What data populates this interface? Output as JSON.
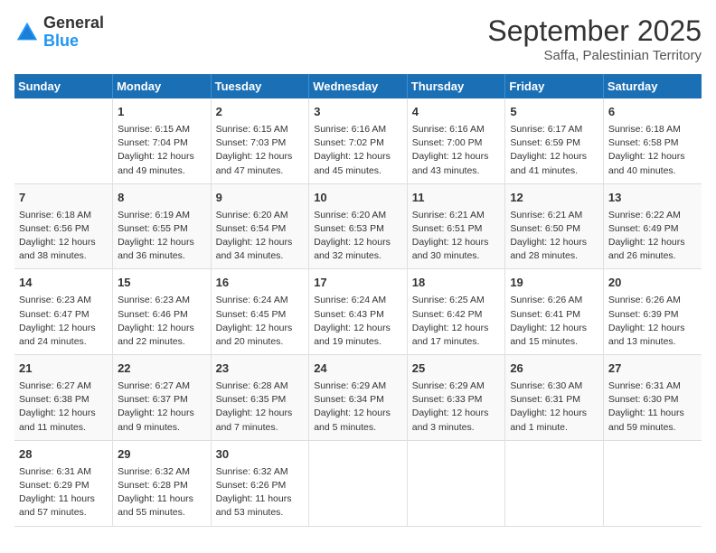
{
  "header": {
    "logo_general": "General",
    "logo_blue": "Blue",
    "month_title": "September 2025",
    "location": "Saffa, Palestinian Territory"
  },
  "days_of_week": [
    "Sunday",
    "Monday",
    "Tuesday",
    "Wednesday",
    "Thursday",
    "Friday",
    "Saturday"
  ],
  "weeks": [
    [
      {
        "day": "",
        "lines": []
      },
      {
        "day": "1",
        "lines": [
          "Sunrise: 6:15 AM",
          "Sunset: 7:04 PM",
          "Daylight: 12 hours",
          "and 49 minutes."
        ]
      },
      {
        "day": "2",
        "lines": [
          "Sunrise: 6:15 AM",
          "Sunset: 7:03 PM",
          "Daylight: 12 hours",
          "and 47 minutes."
        ]
      },
      {
        "day": "3",
        "lines": [
          "Sunrise: 6:16 AM",
          "Sunset: 7:02 PM",
          "Daylight: 12 hours",
          "and 45 minutes."
        ]
      },
      {
        "day": "4",
        "lines": [
          "Sunrise: 6:16 AM",
          "Sunset: 7:00 PM",
          "Daylight: 12 hours",
          "and 43 minutes."
        ]
      },
      {
        "day": "5",
        "lines": [
          "Sunrise: 6:17 AM",
          "Sunset: 6:59 PM",
          "Daylight: 12 hours",
          "and 41 minutes."
        ]
      },
      {
        "day": "6",
        "lines": [
          "Sunrise: 6:18 AM",
          "Sunset: 6:58 PM",
          "Daylight: 12 hours",
          "and 40 minutes."
        ]
      }
    ],
    [
      {
        "day": "7",
        "lines": [
          "Sunrise: 6:18 AM",
          "Sunset: 6:56 PM",
          "Daylight: 12 hours",
          "and 38 minutes."
        ]
      },
      {
        "day": "8",
        "lines": [
          "Sunrise: 6:19 AM",
          "Sunset: 6:55 PM",
          "Daylight: 12 hours",
          "and 36 minutes."
        ]
      },
      {
        "day": "9",
        "lines": [
          "Sunrise: 6:20 AM",
          "Sunset: 6:54 PM",
          "Daylight: 12 hours",
          "and 34 minutes."
        ]
      },
      {
        "day": "10",
        "lines": [
          "Sunrise: 6:20 AM",
          "Sunset: 6:53 PM",
          "Daylight: 12 hours",
          "and 32 minutes."
        ]
      },
      {
        "day": "11",
        "lines": [
          "Sunrise: 6:21 AM",
          "Sunset: 6:51 PM",
          "Daylight: 12 hours",
          "and 30 minutes."
        ]
      },
      {
        "day": "12",
        "lines": [
          "Sunrise: 6:21 AM",
          "Sunset: 6:50 PM",
          "Daylight: 12 hours",
          "and 28 minutes."
        ]
      },
      {
        "day": "13",
        "lines": [
          "Sunrise: 6:22 AM",
          "Sunset: 6:49 PM",
          "Daylight: 12 hours",
          "and 26 minutes."
        ]
      }
    ],
    [
      {
        "day": "14",
        "lines": [
          "Sunrise: 6:23 AM",
          "Sunset: 6:47 PM",
          "Daylight: 12 hours",
          "and 24 minutes."
        ]
      },
      {
        "day": "15",
        "lines": [
          "Sunrise: 6:23 AM",
          "Sunset: 6:46 PM",
          "Daylight: 12 hours",
          "and 22 minutes."
        ]
      },
      {
        "day": "16",
        "lines": [
          "Sunrise: 6:24 AM",
          "Sunset: 6:45 PM",
          "Daylight: 12 hours",
          "and 20 minutes."
        ]
      },
      {
        "day": "17",
        "lines": [
          "Sunrise: 6:24 AM",
          "Sunset: 6:43 PM",
          "Daylight: 12 hours",
          "and 19 minutes."
        ]
      },
      {
        "day": "18",
        "lines": [
          "Sunrise: 6:25 AM",
          "Sunset: 6:42 PM",
          "Daylight: 12 hours",
          "and 17 minutes."
        ]
      },
      {
        "day": "19",
        "lines": [
          "Sunrise: 6:26 AM",
          "Sunset: 6:41 PM",
          "Daylight: 12 hours",
          "and 15 minutes."
        ]
      },
      {
        "day": "20",
        "lines": [
          "Sunrise: 6:26 AM",
          "Sunset: 6:39 PM",
          "Daylight: 12 hours",
          "and 13 minutes."
        ]
      }
    ],
    [
      {
        "day": "21",
        "lines": [
          "Sunrise: 6:27 AM",
          "Sunset: 6:38 PM",
          "Daylight: 12 hours",
          "and 11 minutes."
        ]
      },
      {
        "day": "22",
        "lines": [
          "Sunrise: 6:27 AM",
          "Sunset: 6:37 PM",
          "Daylight: 12 hours",
          "and 9 minutes."
        ]
      },
      {
        "day": "23",
        "lines": [
          "Sunrise: 6:28 AM",
          "Sunset: 6:35 PM",
          "Daylight: 12 hours",
          "and 7 minutes."
        ]
      },
      {
        "day": "24",
        "lines": [
          "Sunrise: 6:29 AM",
          "Sunset: 6:34 PM",
          "Daylight: 12 hours",
          "and 5 minutes."
        ]
      },
      {
        "day": "25",
        "lines": [
          "Sunrise: 6:29 AM",
          "Sunset: 6:33 PM",
          "Daylight: 12 hours",
          "and 3 minutes."
        ]
      },
      {
        "day": "26",
        "lines": [
          "Sunrise: 6:30 AM",
          "Sunset: 6:31 PM",
          "Daylight: 12 hours",
          "and 1 minute."
        ]
      },
      {
        "day": "27",
        "lines": [
          "Sunrise: 6:31 AM",
          "Sunset: 6:30 PM",
          "Daylight: 11 hours",
          "and 59 minutes."
        ]
      }
    ],
    [
      {
        "day": "28",
        "lines": [
          "Sunrise: 6:31 AM",
          "Sunset: 6:29 PM",
          "Daylight: 11 hours",
          "and 57 minutes."
        ]
      },
      {
        "day": "29",
        "lines": [
          "Sunrise: 6:32 AM",
          "Sunset: 6:28 PM",
          "Daylight: 11 hours",
          "and 55 minutes."
        ]
      },
      {
        "day": "30",
        "lines": [
          "Sunrise: 6:32 AM",
          "Sunset: 6:26 PM",
          "Daylight: 11 hours",
          "and 53 minutes."
        ]
      },
      {
        "day": "",
        "lines": []
      },
      {
        "day": "",
        "lines": []
      },
      {
        "day": "",
        "lines": []
      },
      {
        "day": "",
        "lines": []
      }
    ]
  ]
}
